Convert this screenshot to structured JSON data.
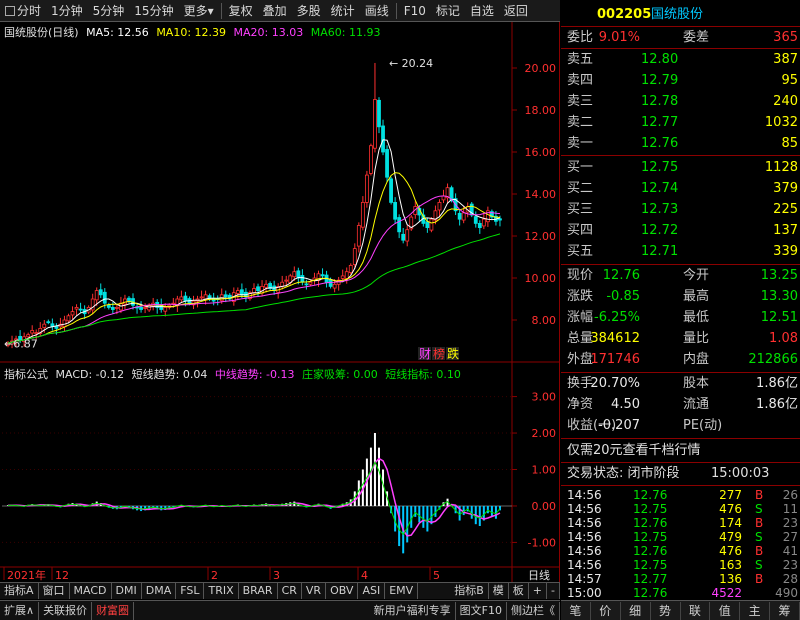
{
  "toolbar": {
    "items": [
      "分时",
      "1分钟",
      "5分钟",
      "15分钟",
      "更多",
      "复权",
      "叠加",
      "多股",
      "统计",
      "画线",
      "F10",
      "标记",
      "自选",
      "返回"
    ]
  },
  "chart_header": {
    "stock_name": "国统股份(日线)",
    "ma5": "MA5: 12.56",
    "ma10": "MA10: 12.39",
    "ma20": "MA20: 13.03",
    "ma60": "MA60: 11.93",
    "high_label": "20.24",
    "low_label": "6.87",
    "badges": [
      "财",
      "榜",
      "跌"
    ]
  },
  "indicator_header": {
    "title": "指标公式",
    "macd": "MACD: -0.12",
    "short_trend": "短线趋势: 0.04",
    "mid_trend": "中线趋势: -0.13",
    "dealer": "庄家吸筹: 0.00",
    "short_ind": "短线指标: 0.10"
  },
  "date_axis": {
    "labels": [
      "2021年",
      "12",
      "2",
      "3",
      "4",
      "5"
    ],
    "right_label": "日线"
  },
  "tabbar1": [
    "指标A",
    "窗口",
    "MACD",
    "DMI",
    "DMA",
    "FSL",
    "TRIX",
    "BRAR",
    "CR",
    "VR",
    "OBV",
    "ASI",
    "EMV",
    "",
    "指标B",
    "模",
    "板",
    "+",
    "-"
  ],
  "tabbar2": [
    "扩展∧",
    "关联报价",
    "财富圈",
    "新用户福利专享",
    "图文F10",
    "侧边栏《"
  ],
  "quote": {
    "code": "002205",
    "name": "国统股份",
    "wb_label": "委比",
    "wb_value": "9.01%",
    "wc_label": "委差",
    "wc_value": "365",
    "asks": [
      {
        "label": "卖五",
        "price": "12.80",
        "vol": "387"
      },
      {
        "label": "卖四",
        "price": "12.79",
        "vol": "95"
      },
      {
        "label": "卖三",
        "price": "12.78",
        "vol": "240"
      },
      {
        "label": "卖二",
        "price": "12.77",
        "vol": "1032"
      },
      {
        "label": "卖一",
        "price": "12.76",
        "vol": "85"
      }
    ],
    "bids": [
      {
        "label": "买一",
        "price": "12.75",
        "vol": "1128"
      },
      {
        "label": "买二",
        "price": "12.74",
        "vol": "379"
      },
      {
        "label": "买三",
        "price": "12.73",
        "vol": "225"
      },
      {
        "label": "买四",
        "price": "12.72",
        "vol": "137"
      },
      {
        "label": "买五",
        "price": "12.71",
        "vol": "339"
      }
    ],
    "stats": [
      {
        "l1": "现价",
        "v1": "12.76",
        "c1": "green",
        "l2": "今开",
        "v2": "13.25",
        "c2": "green"
      },
      {
        "l1": "涨跌",
        "v1": "-0.85",
        "c1": "green",
        "l2": "最高",
        "v2": "13.30",
        "c2": "green"
      },
      {
        "l1": "涨幅",
        "v1": "-6.25%",
        "c1": "green",
        "l2": "最低",
        "v2": "12.51",
        "c2": "green"
      },
      {
        "l1": "总量",
        "v1": "384612",
        "c1": "yellow",
        "l2": "量比",
        "v2": "1.08",
        "c2": "red"
      },
      {
        "l1": "外盘",
        "v1": "171746",
        "c1": "red",
        "l2": "内盘",
        "v2": "212866",
        "c2": "green"
      }
    ],
    "stats2": [
      {
        "l1": "换手",
        "v1": "20.70%",
        "l2": "股本",
        "v2": "1.86亿"
      },
      {
        "l1": "净资",
        "v1": "4.50",
        "l2": "流通",
        "v2": "1.86亿"
      },
      {
        "l1": "收益(一)",
        "v1": "-0.207",
        "l2": "PE(动)",
        "v2": ""
      }
    ],
    "promo": "仅需20元查看千档行情",
    "status_label": "交易状态: 闭市阶段",
    "status_time": "15:00:03",
    "ticks": [
      {
        "t": "14:56",
        "p": "12.76",
        "v": "277",
        "s": "B",
        "n": "26"
      },
      {
        "t": "14:56",
        "p": "12.75",
        "v": "476",
        "s": "S",
        "n": "11"
      },
      {
        "t": "14:56",
        "p": "12.76",
        "v": "174",
        "s": "B",
        "n": "23"
      },
      {
        "t": "14:56",
        "p": "12.75",
        "v": "479",
        "s": "S",
        "n": "27"
      },
      {
        "t": "14:56",
        "p": "12.76",
        "v": "476",
        "s": "B",
        "n": "41"
      },
      {
        "t": "14:56",
        "p": "12.75",
        "v": "163",
        "s": "S",
        "n": "23"
      },
      {
        "t": "14:57",
        "p": "12.77",
        "v": "136",
        "s": "B",
        "n": "28"
      },
      {
        "t": "15:00",
        "p": "12.76",
        "v": "4522",
        "s": "",
        "n": "490"
      }
    ],
    "bottom_tabs": [
      "笔",
      "价",
      "细",
      "势",
      "联",
      "值",
      "主",
      "筹"
    ]
  },
  "chart_data": {
    "type": "candlestick",
    "price_axis": [
      "20.00",
      "18.00",
      "16.00",
      "14.00",
      "12.00",
      "10.00",
      "8.00"
    ],
    "price_range": [
      6.0,
      21.0
    ],
    "macd_axis": [
      "3.00",
      "2.00",
      "1.00",
      "0.00",
      "-1.00"
    ],
    "macd_range": [
      -1.4,
      3.4
    ],
    "closes": [
      6.9,
      7.0,
      7.1,
      7.05,
      7.2,
      7.3,
      7.5,
      7.4,
      7.6,
      7.8,
      7.9,
      7.7,
      7.6,
      7.8,
      8.0,
      8.2,
      8.4,
      8.6,
      8.5,
      8.3,
      8.6,
      9.0,
      9.4,
      9.2,
      8.8,
      8.6,
      8.5,
      8.6,
      8.8,
      9.0,
      8.9,
      8.7,
      8.6,
      8.5,
      8.6,
      8.7,
      8.8,
      8.6,
      8.5,
      8.6,
      8.7,
      8.8,
      9.0,
      9.1,
      8.9,
      8.8,
      8.9,
      9.0,
      9.1,
      9.2,
      9.0,
      8.9,
      9.0,
      9.2,
      9.1,
      9.0,
      9.3,
      9.4,
      9.2,
      9.1,
      9.3,
      9.5,
      9.4,
      9.6,
      9.7,
      9.5,
      9.4,
      9.6,
      9.8,
      9.9,
      10.1,
      10.3,
      10.0,
      9.8,
      9.7,
      9.8,
      10.0,
      10.2,
      10.1,
      9.8,
      9.6,
      9.7,
      9.9,
      10.1,
      10.3,
      10.6,
      11.4,
      12.5,
      13.6,
      14.9,
      16.3,
      18.5,
      17.2,
      16.0,
      14.8,
      13.6,
      12.8,
      12.2,
      11.8,
      12.3,
      12.9,
      13.4,
      13.0,
      12.6,
      12.4,
      12.8,
      13.2,
      13.6,
      13.9,
      14.3,
      13.7,
      13.2,
      12.8,
      13.1,
      13.4,
      13.0,
      12.6,
      12.4,
      12.8,
      13.2,
      12.9,
      12.7,
      12.76
    ],
    "macd_hist": [
      0.02,
      0.03,
      0.02,
      0.0,
      -0.02,
      0.03,
      0.05,
      0.04,
      0.02,
      0.03,
      0.05,
      0.02,
      -0.02,
      -0.04,
      0.02,
      0.06,
      0.08,
      0.06,
      0.03,
      -0.03,
      0.0,
      0.07,
      0.12,
      0.08,
      0.01,
      -0.05,
      -0.08,
      -0.09,
      -0.06,
      -0.02,
      -0.05,
      -0.09,
      -0.12,
      -0.14,
      -0.12,
      -0.09,
      -0.06,
      -0.09,
      -0.12,
      -0.11,
      -0.08,
      -0.05,
      0.0,
      0.03,
      0.0,
      -0.03,
      -0.04,
      -0.02,
      0.01,
      0.03,
      0.0,
      -0.03,
      -0.02,
      0.02,
      0.0,
      -0.03,
      0.02,
      0.04,
      0.0,
      -0.02,
      0.01,
      0.04,
      0.02,
      0.05,
      0.07,
      0.03,
      0.0,
      0.03,
      0.06,
      0.08,
      0.1,
      0.12,
      0.06,
      0.0,
      -0.04,
      -0.02,
      0.03,
      0.06,
      0.04,
      -0.03,
      -0.08,
      -0.05,
      0.01,
      0.06,
      0.1,
      0.18,
      0.4,
      0.7,
      1.0,
      1.3,
      1.6,
      2.0,
      1.6,
      1.0,
      0.4,
      -0.2,
      -0.7,
      -1.1,
      -1.3,
      -1.0,
      -0.6,
      -0.3,
      -0.45,
      -0.6,
      -0.7,
      -0.5,
      -0.3,
      -0.1,
      0.1,
      0.2,
      0.0,
      -0.2,
      -0.4,
      -0.25,
      -0.15,
      -0.35,
      -0.5,
      -0.55,
      -0.4,
      -0.2,
      -0.3,
      -0.35,
      -0.12
    ]
  }
}
